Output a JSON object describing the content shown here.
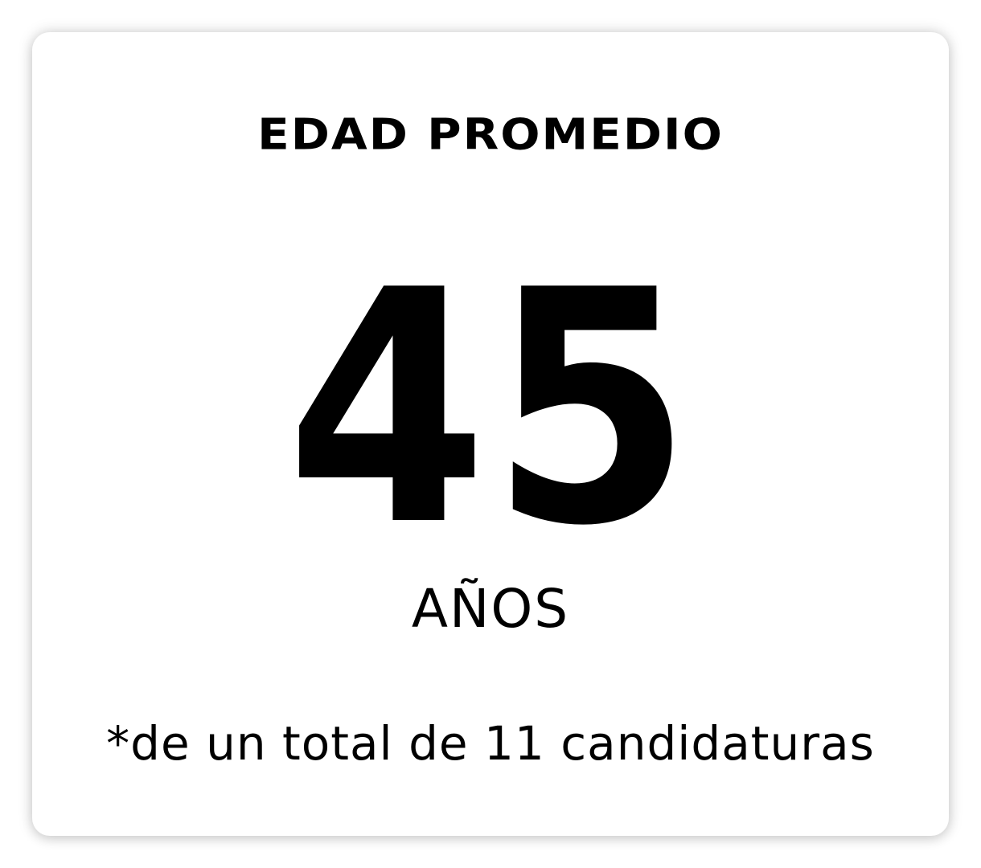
{
  "stat": {
    "title": "EDAD PROMEDIO",
    "value": "45",
    "unit": "AÑOS",
    "note": "*de un total de 11 candidaturas"
  },
  "colors": {
    "text": "#000000",
    "background": "#ffffff"
  }
}
